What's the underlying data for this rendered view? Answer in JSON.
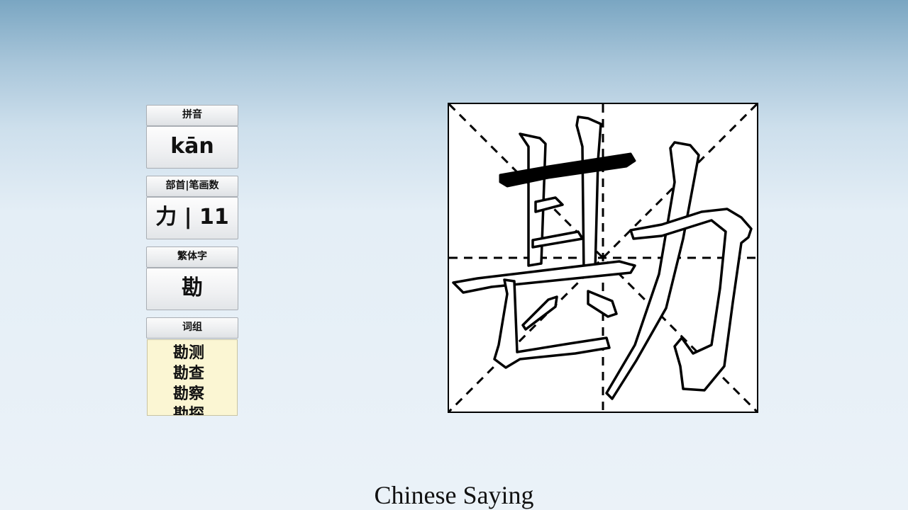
{
  "panel": {
    "pinyin_label": "拼音",
    "pinyin_value": "kān",
    "radical_label": "部首|笔画数",
    "radical_value": "力 | 11",
    "traditional_label": "繁体字",
    "traditional_value": "勘",
    "words_label": "词组",
    "words": [
      "勘测",
      "勘查",
      "勘察",
      "勘探"
    ]
  },
  "caption": "Chinese Saying",
  "colors": {
    "words_background": "#fbf6d3",
    "grid_border": "#000000",
    "stroke_highlight": "#000000"
  }
}
